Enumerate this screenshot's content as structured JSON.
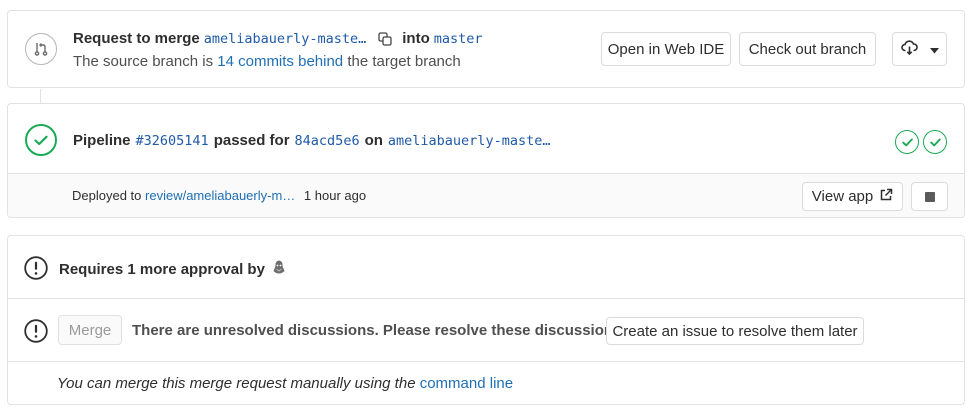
{
  "merge_request": {
    "prefix": "Request to merge",
    "source_branch": "ameliabauerly-maste…",
    "into_label": "into",
    "target_branch": "master",
    "status_prefix": "The source branch is",
    "commits_behind": "14 commits behind",
    "status_suffix": "the target branch",
    "buttons": {
      "web_ide": "Open in Web IDE",
      "checkout": "Check out branch"
    }
  },
  "pipeline": {
    "label": "Pipeline",
    "id": "#32605141",
    "status_text": "passed for",
    "commit": "84acd5e6",
    "on_label": "on",
    "branch": "ameliabauerly-maste…",
    "stages": [
      "passed",
      "passed"
    ],
    "status_color": "#1aaa55"
  },
  "deployment": {
    "prefix": "Deployed to",
    "environment": "review/ameliabauerly-m…",
    "time": "1 hour ago",
    "view_app": "View app"
  },
  "approval": {
    "text": "Requires 1 more approval by"
  },
  "merge_section": {
    "merge_button": "Merge",
    "unresolved_text": "There are unresolved discussions. Please resolve these discussions",
    "create_issue_button": "Create an issue to resolve them later",
    "manual_prefix": "You can merge this merge request manually using the",
    "command_line": "command line"
  }
}
